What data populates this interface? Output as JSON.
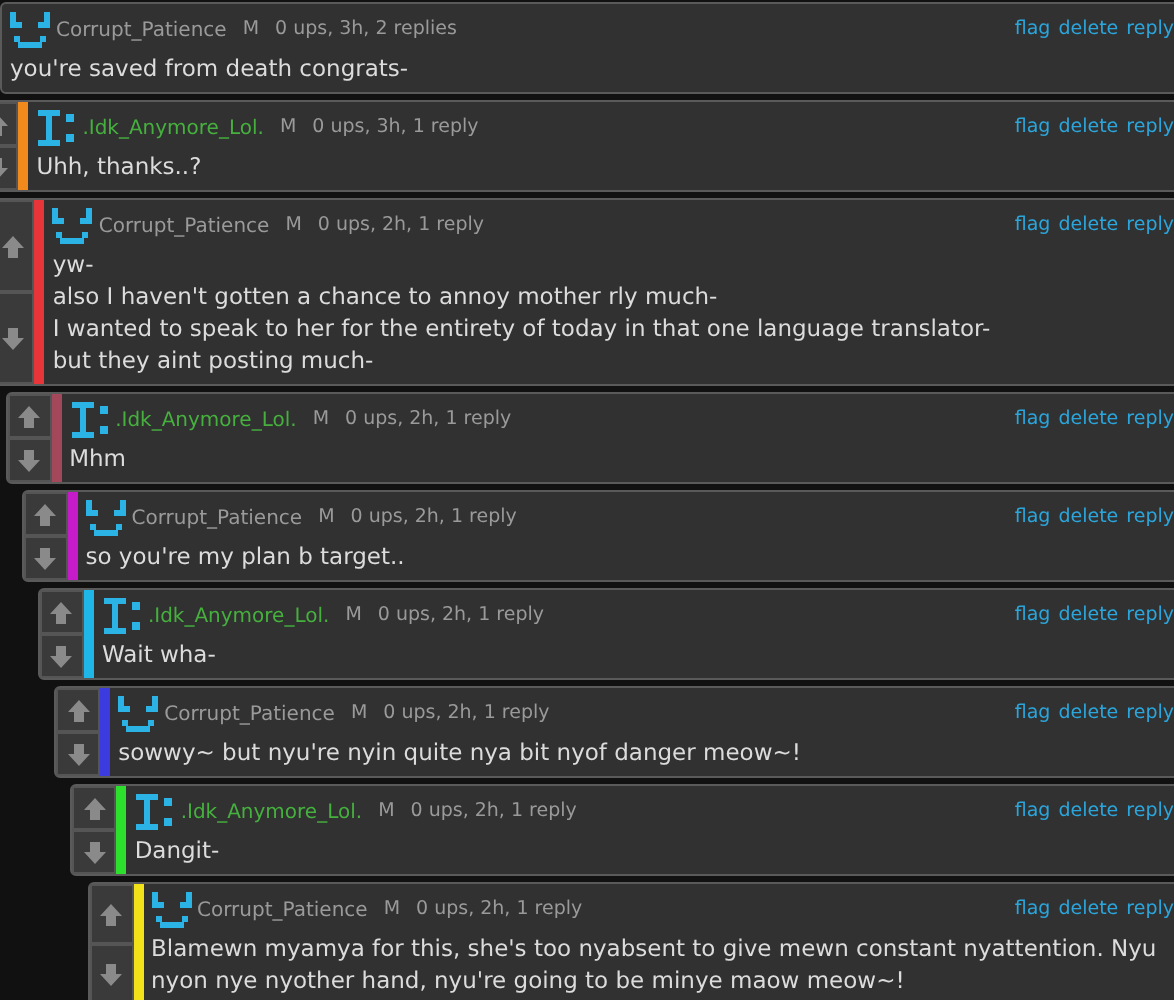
{
  "comments": [
    {
      "kind": "smile",
      "username": "Corrupt_Patience",
      "mark": "M",
      "meta": "0 ups, 3h, 2 replies",
      "text": "you're saved from death congrats-",
      "actions": [
        "flag",
        "delete",
        "reply"
      ],
      "children": [
        {
          "kind": "letter",
          "color": "#f08a1c",
          "username": ".Idk_Anymore_Lol.",
          "mark": "M",
          "meta": "0 ups, 3h, 1 reply",
          "text": "Uhh, thanks..?",
          "actions": [
            "flag",
            "delete",
            "reply"
          ],
          "children": [
            {
              "kind": "smile",
              "color": "#e8353a",
              "username": "Corrupt_Patience",
              "mark": "M",
              "meta": "0 ups, 2h, 1 reply",
              "text": "yw-\nalso I haven't gotten a chance to annoy mother rly much-\nI wanted to speak to her for the entirety of today in that one language translator-\nbut they aint posting much-",
              "actions": [
                "flag",
                "delete",
                "reply"
              ],
              "children": [
                {
                  "kind": "letter",
                  "color": "#a3485a",
                  "username": ".Idk_Anymore_Lol.",
                  "mark": "M",
                  "meta": "0 ups, 2h, 1 reply",
                  "text": "Mhm",
                  "actions": [
                    "flag",
                    "delete",
                    "reply"
                  ],
                  "children": [
                    {
                      "kind": "smile",
                      "color": "#c51bc8",
                      "username": "Corrupt_Patience",
                      "mark": "M",
                      "meta": "0 ups, 2h, 1 reply",
                      "text": "so you're my plan b target..",
                      "actions": [
                        "flag",
                        "delete",
                        "reply"
                      ],
                      "children": [
                        {
                          "kind": "letter",
                          "color": "#1fb6e8",
                          "username": ".Idk_Anymore_Lol.",
                          "mark": "M",
                          "meta": "0 ups, 2h, 1 reply",
                          "text": "Wait wha-",
                          "actions": [
                            "flag",
                            "delete",
                            "reply"
                          ],
                          "children": [
                            {
                              "kind": "smile",
                              "color": "#3b3be0",
                              "username": "Corrupt_Patience",
                              "mark": "M",
                              "meta": "0 ups, 2h, 1 reply",
                              "text": "sowwy~ but nyu're nyin quite nya bit nyof danger meow~!",
                              "actions": [
                                "flag",
                                "delete",
                                "reply"
                              ],
                              "children": [
                                {
                                  "kind": "letter",
                                  "color": "#2ee02e",
                                  "username": ".Idk_Anymore_Lol.",
                                  "mark": "M",
                                  "meta": "0 ups, 2h, 1 reply",
                                  "text": "Dangit-",
                                  "actions": [
                                    "flag",
                                    "delete",
                                    "reply"
                                  ],
                                  "children": [
                                    {
                                      "kind": "smile",
                                      "color": "#f2e21a",
                                      "username": "Corrupt_Patience",
                                      "mark": "M",
                                      "meta": "0 ups, 2h, 1 reply",
                                      "text": "Blamewn myamya for this, she's too nyabsent to give mewn constant nyattention. Nyu nyon nye nyother hand, nyu're going to be minye maow meow~!",
                                      "actions": [
                                        "flag",
                                        "delete",
                                        "reply"
                                      ]
                                    }
                                  ]
                                }
                              ]
                            }
                          ]
                        }
                      ]
                    }
                  ]
                }
              ]
            }
          ]
        }
      ]
    }
  ]
}
